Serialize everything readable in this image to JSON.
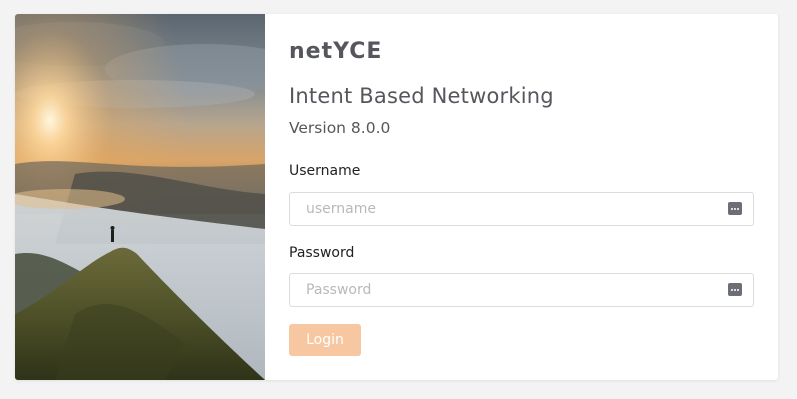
{
  "logo": {
    "text": "netYCE"
  },
  "heading": {
    "title": "Intent Based Networking",
    "version": "Version 8.0.0"
  },
  "form": {
    "username": {
      "label": "Username",
      "placeholder": "username",
      "value": ""
    },
    "password": {
      "label": "Password",
      "placeholder": "Password",
      "value": ""
    },
    "login_label": "Login"
  },
  "colors": {
    "page_background": "#f3f3f4",
    "card_background": "#ffffff",
    "text": "#55575c",
    "login_button": "#f7c7a1",
    "field_border": "#dcdcdf"
  },
  "icons": {
    "field_icon": "keyboard-icon"
  }
}
